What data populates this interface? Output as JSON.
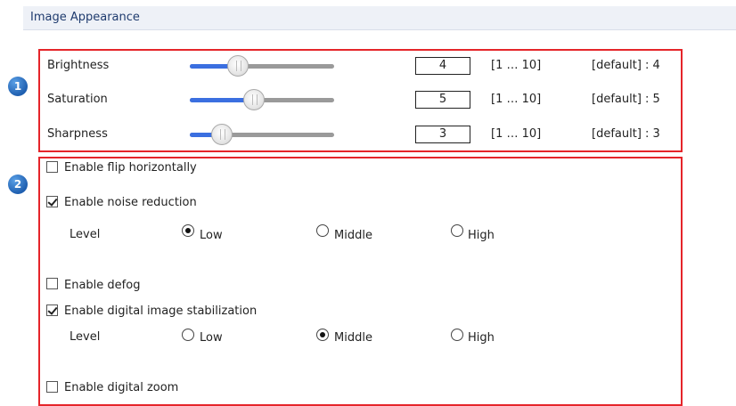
{
  "header": {
    "title": "Image Appearance"
  },
  "badges": [
    "1",
    "2"
  ],
  "sliders": [
    {
      "label": "Brightness",
      "value": "4",
      "range": "[1 … 10]",
      "default": "[default] : 4",
      "fraction": 0.333
    },
    {
      "label": "Saturation",
      "value": "5",
      "range": "[1 … 10]",
      "default": "[default] : 5",
      "fraction": 0.444
    },
    {
      "label": "Sharpness",
      "value": "3",
      "range": "[1 … 10]",
      "default": "[default] : 3",
      "fraction": 0.222
    }
  ],
  "options": {
    "flip": {
      "label": "Enable flip horizontally",
      "checked": false
    },
    "noise": {
      "label": "Enable noise reduction",
      "checked": true,
      "level_label": "Level",
      "levels": [
        {
          "label": "Low",
          "selected": true
        },
        {
          "label": "Middle",
          "selected": false
        },
        {
          "label": "High",
          "selected": false
        }
      ]
    },
    "defog": {
      "label": "Enable defog",
      "checked": false
    },
    "dis": {
      "label": "Enable digital image stabilization",
      "checked": true,
      "level_label": "Level",
      "levels": [
        {
          "label": "Low",
          "selected": false
        },
        {
          "label": "Middle",
          "selected": true
        },
        {
          "label": "High",
          "selected": false
        }
      ]
    },
    "zoom": {
      "label": "Enable digital zoom",
      "checked": false
    }
  },
  "colors": {
    "accent": "#3b6fe0",
    "highlight": "#e5252a",
    "badge": "#1f5fb0"
  }
}
